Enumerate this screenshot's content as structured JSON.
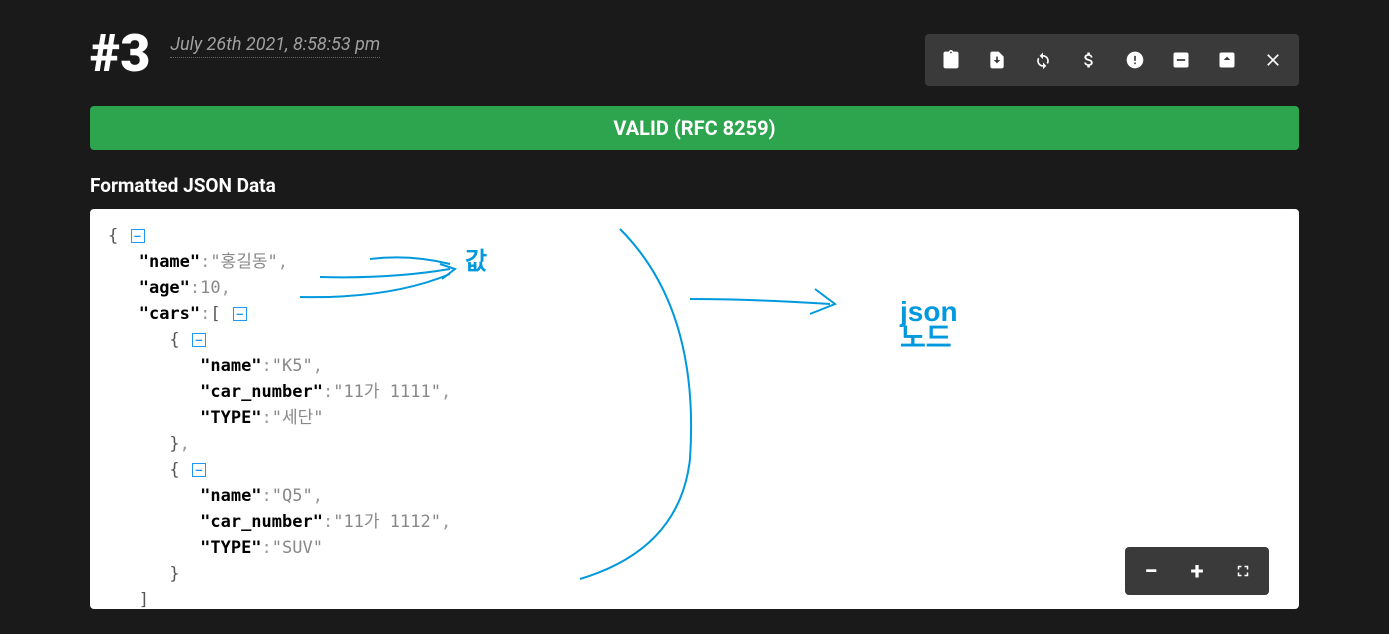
{
  "header": {
    "tab_number": "#3",
    "timestamp": "July 26th 2021, 8:58:53 pm"
  },
  "banner": {
    "text": "VALID (RFC 8259)"
  },
  "section": {
    "title": "Formatted JSON Data"
  },
  "annotations": {
    "value_label": "값",
    "node_label": "json 노드"
  },
  "json_tree": {
    "name_key": "\"name\"",
    "name_val": "\"홍길동\"",
    "age_key": "\"age\"",
    "age_val": "10",
    "cars_key": "\"cars\"",
    "car0_name_key": "\"name\"",
    "car0_name_val": "\"K5\"",
    "car0_num_key": "\"car_number\"",
    "car0_num_val": "\"11가 1111\"",
    "car0_type_key": "\"TYPE\"",
    "car0_type_val": "\"세단\"",
    "car1_name_key": "\"name\"",
    "car1_name_val": "\"Q5\"",
    "car1_num_key": "\"car_number\"",
    "car1_num_val": "\"11가 1112\"",
    "car1_type_key": "\"TYPE\"",
    "car1_type_val": "\"SUV\""
  }
}
